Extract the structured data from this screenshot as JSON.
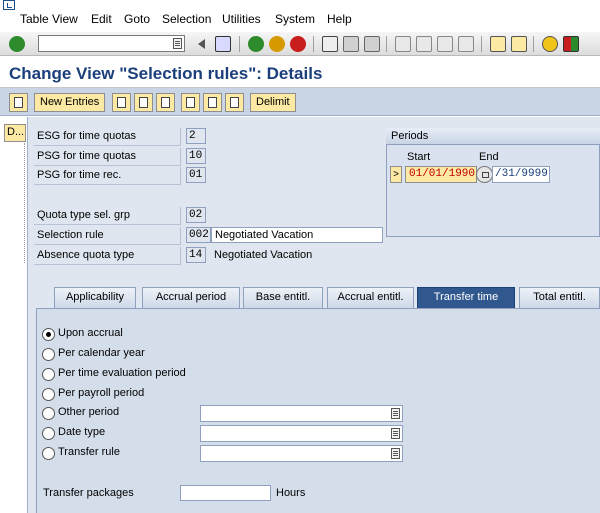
{
  "menu": {
    "items": [
      "Table View",
      "Edit",
      "Goto",
      "Selection",
      "Utilities",
      "System",
      "Help"
    ]
  },
  "toolbar": {
    "command_value": "",
    "icons": [
      "check-icon",
      "back-arrow-icon",
      "save-icon",
      "green-back-icon",
      "exit-icon",
      "cancel-icon",
      "print-icon",
      "find-icon",
      "find-next-icon",
      "first-page-icon",
      "prev-page-icon",
      "next-page-icon",
      "last-page-icon",
      "new-session-icon",
      "shortcut-icon",
      "help-icon",
      "customize-layout-icon"
    ]
  },
  "title": "Change View \"Selection rules\": Details",
  "app_toolbar": {
    "new_entries": "New Entries",
    "delimit": "Delimit"
  },
  "tree": {
    "node_label": "D..."
  },
  "fields": {
    "esg_label": "ESG for time quotas",
    "esg_value": "2",
    "psg_quota_label": "PSG for time quotas",
    "psg_quota_value": "10",
    "psg_rec_label": "PSG for time rec.",
    "psg_rec_value": "01",
    "quota_type_label": "Quota type sel. grp",
    "quota_type_value": "02",
    "selection_rule_label": "Selection rule",
    "selection_rule_value": "002",
    "selection_rule_text": "Negotiated Vacation",
    "absence_quota_label": "Absence quota type",
    "absence_quota_value": "14",
    "absence_quota_text": "Negotiated Vacation"
  },
  "periods": {
    "title": "Periods",
    "start_label": "Start",
    "end_label": "End",
    "marker": ">",
    "start_value": "01/01/1990",
    "end_value": "/31/9999"
  },
  "tabs": [
    {
      "label": "Applicability",
      "active": false
    },
    {
      "label": "Accrual period",
      "active": false
    },
    {
      "label": "Base entitl.",
      "active": false
    },
    {
      "label": "Accrual entitl.",
      "active": false
    },
    {
      "label": "Transfer time",
      "active": true
    },
    {
      "label": "Total entitl.",
      "active": false
    }
  ],
  "transfer": {
    "options": [
      {
        "label": "Upon accrual",
        "checked": true
      },
      {
        "label": "Per calendar year",
        "checked": false
      },
      {
        "label": "Per time evaluation period",
        "checked": false
      },
      {
        "label": "Per payroll period",
        "checked": false
      },
      {
        "label": "Other period",
        "checked": false
      },
      {
        "label": "Date type",
        "checked": false
      },
      {
        "label": "Transfer rule",
        "checked": false
      }
    ],
    "packages_label": "Transfer packages",
    "packages_value": "",
    "packages_unit": "Hours"
  }
}
